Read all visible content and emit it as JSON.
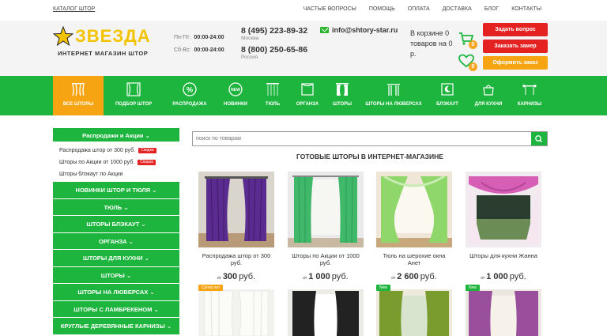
{
  "topbar": {
    "catalog": "КАТАЛОГ ШТОР",
    "links": [
      "ЧАСТЫЕ ВОПРОСЫ",
      "ПОМОЩЬ",
      "ОПЛАТА",
      "ДОСТАВКА",
      "БЛОГ",
      "КОНТАКТЫ"
    ]
  },
  "header": {
    "brand": "ЗВЕЗДА",
    "tagline": "ИНТЕРНЕТ МАГАЗИН ШТОР",
    "hours": [
      {
        "days": "Пн-Пт:",
        "time": "00:00-24:00"
      },
      {
        "days": "Сб-Вс:",
        "time": "00:00-24:00"
      }
    ],
    "phones": [
      {
        "number": "8 (495) 223-89-32",
        "city": "Москва"
      },
      {
        "number": "8 (800) 250-65-86",
        "city": "Россия"
      }
    ],
    "email": "info@shtory-star.ru",
    "cart_text": "В корзине 0 товаров на 0 р.",
    "cart_count": "0",
    "fav_count": "0",
    "buttons": [
      "Задать вопрос",
      "Заказать замер",
      "Оформить заказ"
    ]
  },
  "nav": [
    {
      "label": "ВСЕ ШТОРЫ",
      "icon": "curtain-icon",
      "active": true
    },
    {
      "label": "ПОДБОР ШТОР",
      "icon": "curtain-select-icon"
    },
    {
      "label": "РАСПРОДАЖА",
      "icon": "percent-icon"
    },
    {
      "label": "НОВИНКИ",
      "icon": "new-icon"
    },
    {
      "label": "ТЮЛЬ",
      "icon": "tulle-icon"
    },
    {
      "label": "ОРГАНЗА",
      "icon": "organza-icon"
    },
    {
      "label": "ШТОРЫ",
      "icon": "drapes-icon"
    },
    {
      "label": "ШТОРЫ НА ЛЮВЕРСАХ",
      "icon": "grommet-icon"
    },
    {
      "label": "БЛЭКАУТ",
      "icon": "blackout-icon"
    },
    {
      "label": "ДЛЯ КУХНИ",
      "icon": "kitchen-icon"
    },
    {
      "label": "КАРНИЗЫ",
      "icon": "rod-icon"
    }
  ],
  "sidebar": {
    "head": "Распродажи и Акции",
    "sub": [
      {
        "label": "Распродажа штор от 300 руб.",
        "tag": "Скидка"
      },
      {
        "label": "Шторы по Акции от 1000 руб.",
        "tag": "Скидка"
      },
      {
        "label": "Шторы блэкаут по Акции",
        "tag": ""
      }
    ],
    "categories": [
      "НОВИНКИ ШТОР И ТЮЛЯ",
      "ТЮЛЬ",
      "ШТОРЫ БЛЭКАУТ",
      "ОРГАНЗА",
      "ШТОРЫ ДЛЯ КУХНИ",
      "ШТОРЫ",
      "ШТОРЫ НА ЛЮВЕРСАХ",
      "ШТОРЫ С ЛАМБРЕКЕНОМ",
      "КРУГЛЫЕ ДЕРЕВЯННЫЕ КАРНИЗЫ"
    ]
  },
  "search": {
    "placeholder": "поиск по товарам"
  },
  "main": {
    "title": "ГОТОВЫЕ ШТОРЫ В ИНТЕРНЕТ-МАГАЗИНЕ",
    "products": [
      {
        "name": "Распродажа штор от 300 руб.",
        "ot": "от",
        "price": "300",
        "cur": "руб."
      },
      {
        "name": "Шторы по Акции от 1000 руб.",
        "ot": "от",
        "price": "1 000",
        "cur": "руб."
      },
      {
        "name": "Тюль на шерохие окна Анет",
        "ot": "от",
        "price": "2 600",
        "cur": "руб."
      },
      {
        "name": "Шторы для кухни Жанна",
        "ot": "от",
        "price": "1 000",
        "cur": "руб."
      }
    ],
    "row2_labels": [
      "Супер хит",
      "",
      "New",
      "New"
    ]
  },
  "colors": {
    "green": "#1db53e",
    "orange": "#f7a412",
    "red": "#e52222",
    "yellow": "#f3c300"
  }
}
